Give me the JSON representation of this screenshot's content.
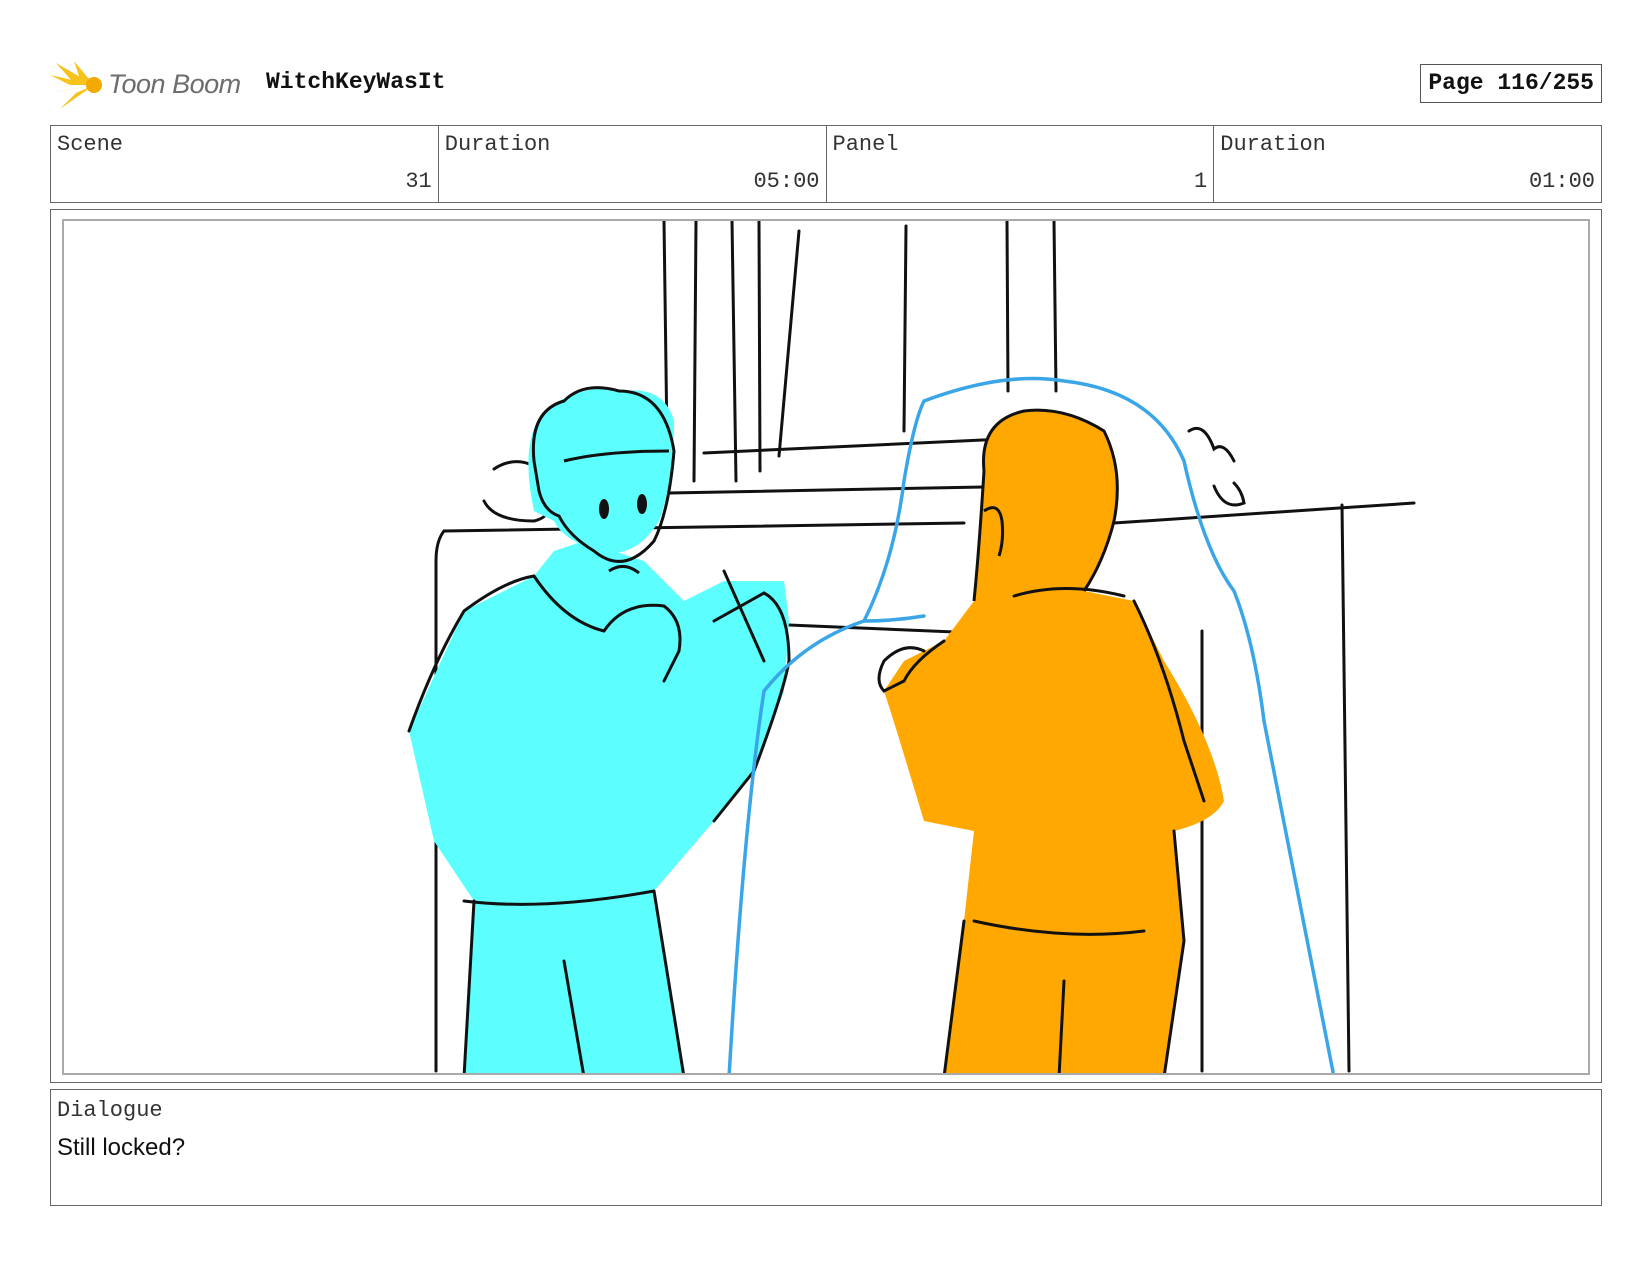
{
  "header": {
    "logo_text": "Toon Boom",
    "project_title": "WitchKeyWasIt",
    "page_indicator": "Page 116/255"
  },
  "meta": {
    "scene_label": "Scene",
    "scene_value": "31",
    "scene_duration_label": "Duration",
    "scene_duration_value": "05:00",
    "panel_label": "Panel",
    "panel_value": "1",
    "panel_duration_label": "Duration",
    "panel_duration_value": "01:00"
  },
  "dialogue": {
    "label": "Dialogue",
    "text": "Still locked?"
  },
  "colors": {
    "logo_yellow": "#f7c21a",
    "character_left_fill": "#5cfffd",
    "character_right_fill": "#ffa801",
    "ghost_outline": "#3aa6e8",
    "ink": "#111111"
  }
}
